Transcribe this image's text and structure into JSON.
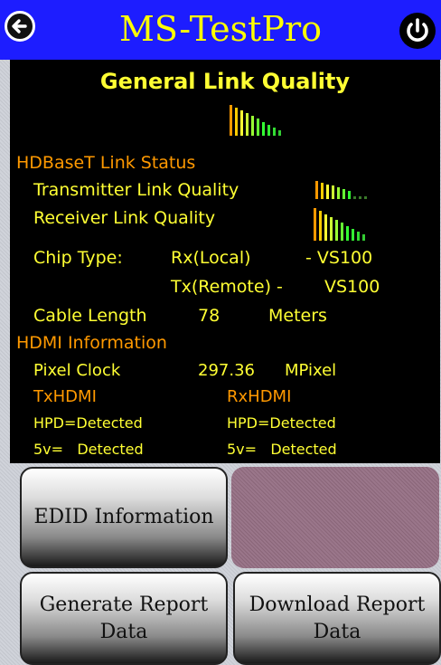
{
  "header": {
    "title": "MS-TestPro",
    "back_icon": "back-arrow-icon",
    "power_icon": "power-icon",
    "bg_color": "#1d1dff",
    "title_color": "#ffff00"
  },
  "status": {
    "general_link_quality_label": "General Link Quality",
    "general_link_quality_bars": 10,
    "hdbaset_heading": "HDBaseT Link Status",
    "transmitter_label": "Transmitter Link Quality",
    "transmitter_bars": 7,
    "receiver_label": "Receiver Link Quality",
    "receiver_bars": 10,
    "chip_type_label": "Chip Type:",
    "rx_label": "Rx(Local)",
    "rx_value": "- VS100",
    "tx_label": "Tx(Remote) -",
    "tx_value": "VS100",
    "cable_length_label": "Cable Length",
    "cable_length_value": "78",
    "cable_length_unit": "Meters",
    "hdmi_heading": "HDMI Information",
    "pixel_clock_label": "Pixel Clock",
    "pixel_clock_value": "297.36",
    "pixel_clock_unit": "MPixel",
    "tx_hdmi_label": "TxHDMI",
    "rx_hdmi_label": "RxHDMI",
    "tx_hpd": "HPD=Detected",
    "rx_hpd": "HPD=Detected",
    "tx_5v": "5v=   Detected",
    "rx_5v": "5v=   Detected",
    "text_color": "#ffff33",
    "heading_color": "#ff9900"
  },
  "buttons": {
    "edid": "EDID Information",
    "generate_report": "Generate Report Data",
    "download_report": "Download Report Data"
  }
}
